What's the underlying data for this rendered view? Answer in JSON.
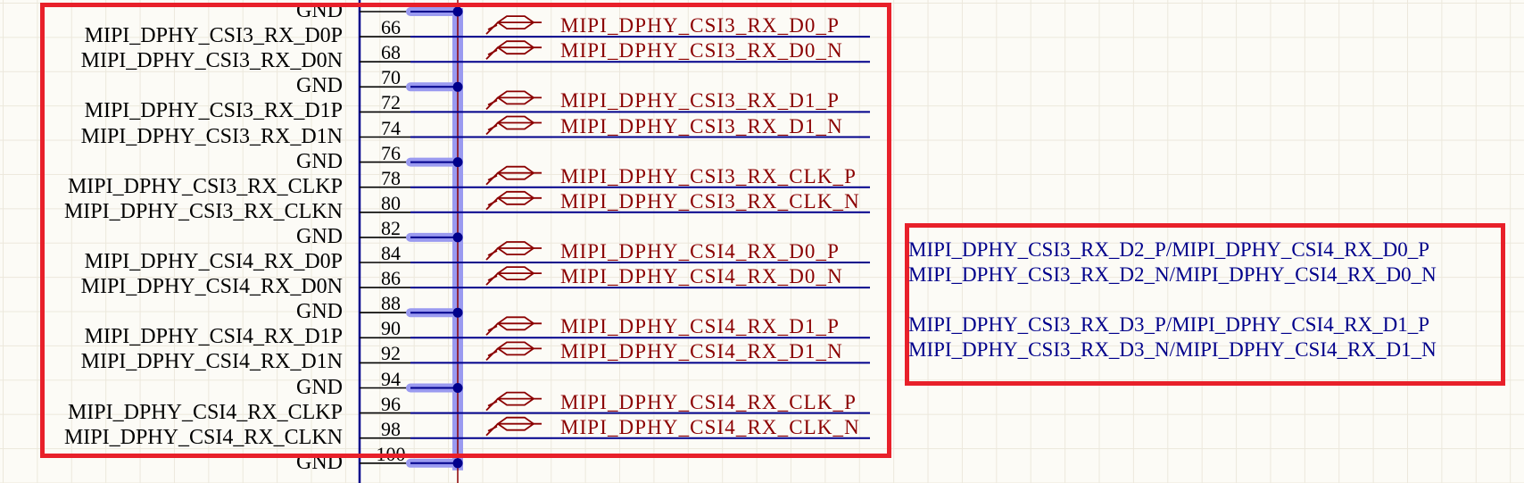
{
  "rows": [
    {
      "signal": "GND",
      "pin": "",
      "net": ""
    },
    {
      "signal": "MIPI_DPHY_CSI3_RX_D0P",
      "pin": "66",
      "net": "MIPI_DPHY_CSI3_RX_D0_P"
    },
    {
      "signal": "MIPI_DPHY_CSI3_RX_D0N",
      "pin": "68",
      "net": "MIPI_DPHY_CSI3_RX_D0_N"
    },
    {
      "signal": "GND",
      "pin": "70",
      "net": ""
    },
    {
      "signal": "MIPI_DPHY_CSI3_RX_D1P",
      "pin": "72",
      "net": "MIPI_DPHY_CSI3_RX_D1_P"
    },
    {
      "signal": "MIPI_DPHY_CSI3_RX_D1N",
      "pin": "74",
      "net": "MIPI_DPHY_CSI3_RX_D1_N"
    },
    {
      "signal": "GND",
      "pin": "76",
      "net": ""
    },
    {
      "signal": "MIPI_DPHY_CSI3_RX_CLKP",
      "pin": "78",
      "net": "MIPI_DPHY_CSI3_RX_CLK_P"
    },
    {
      "signal": "MIPI_DPHY_CSI3_RX_CLKN",
      "pin": "80",
      "net": "MIPI_DPHY_CSI3_RX_CLK_N"
    },
    {
      "signal": "GND",
      "pin": "82",
      "net": ""
    },
    {
      "signal": "MIPI_DPHY_CSI4_RX_D0P",
      "pin": "84",
      "net": "MIPI_DPHY_CSI4_RX_D0_P"
    },
    {
      "signal": "MIPI_DPHY_CSI4_RX_D0N",
      "pin": "86",
      "net": "MIPI_DPHY_CSI4_RX_D0_N"
    },
    {
      "signal": "GND",
      "pin": "88",
      "net": ""
    },
    {
      "signal": "MIPI_DPHY_CSI4_RX_D1P",
      "pin": "90",
      "net": "MIPI_DPHY_CSI4_RX_D1_P"
    },
    {
      "signal": "MIPI_DPHY_CSI4_RX_D1N",
      "pin": "92",
      "net": "MIPI_DPHY_CSI4_RX_D1_N"
    },
    {
      "signal": "GND",
      "pin": "94",
      "net": ""
    },
    {
      "signal": "MIPI_DPHY_CSI4_RX_CLKP",
      "pin": "96",
      "net": "MIPI_DPHY_CSI4_RX_CLK_P"
    },
    {
      "signal": "MIPI_DPHY_CSI4_RX_CLKN",
      "pin": "98",
      "net": "MIPI_DPHY_CSI4_RX_CLK_N"
    },
    {
      "signal": "GND",
      "pin": "100",
      "net": ""
    }
  ],
  "notes": [
    "MIPI_DPHY_CSI3_RX_D2_P/MIPI_DPHY_CSI4_RX_D0_P",
    "MIPI_DPHY_CSI3_RX_D2_N/MIPI_DPHY_CSI4_RX_D0_N",
    "MIPI_DPHY_CSI3_RX_D3_P/MIPI_DPHY_CSI4_RX_D1_P",
    "MIPI_DPHY_CSI3_RX_D3_N/MIPI_DPHY_CSI4_RX_D1_N"
  ],
  "colors": {
    "wire": "#00008b",
    "net_label": "#8b0000",
    "note": "#00008b",
    "highlight_box": "#e8202a",
    "gnd_bus": "#9a9af0"
  },
  "icons": {
    "net_port": "differential-port-icon"
  }
}
